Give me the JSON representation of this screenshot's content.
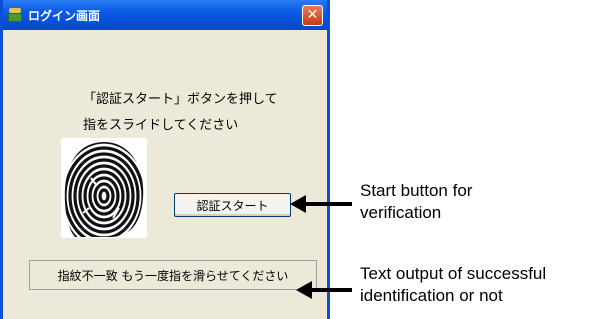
{
  "window": {
    "title": "ログイン画面",
    "close_glyph": "✕"
  },
  "instructions": {
    "line1": "「認証スタート」ボタンを押して",
    "line2": "指をスライドしてください"
  },
  "fingerprint": {
    "icon": "fingerprint-image"
  },
  "start_button": {
    "label": "認証スタート"
  },
  "status": {
    "text": "指紋不一致 もう一度指を滑らせてください"
  },
  "annotations": {
    "start": {
      "line1": "Start button for",
      "line2": "verification"
    },
    "status": {
      "line1": "Text output of successful",
      "line2": "identification or not"
    }
  },
  "colors": {
    "titlebar": "#0a5ae6",
    "window_bg": "#ece9d8",
    "close_btn": "#c93a1a"
  }
}
